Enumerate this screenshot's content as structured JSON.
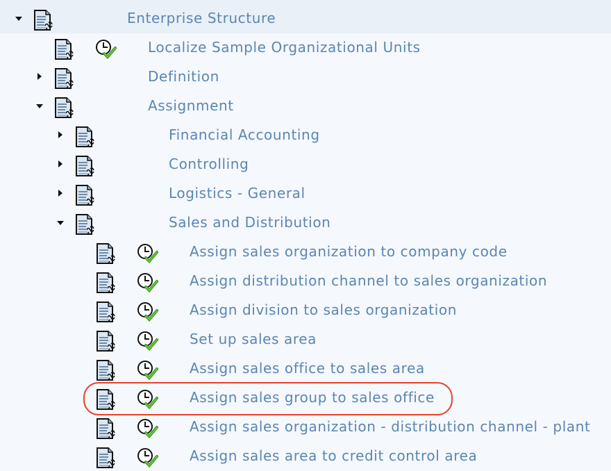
{
  "tree": {
    "items": [
      {
        "label": "Enterprise Structure",
        "level": 0,
        "expander": "expanded",
        "has_clock": false
      },
      {
        "label": "Localize Sample Organizational Units",
        "level": 1,
        "expander": "none",
        "has_clock": true
      },
      {
        "label": "Definition",
        "level": 1,
        "expander": "collapsed",
        "has_clock": false
      },
      {
        "label": "Assignment",
        "level": 1,
        "expander": "expanded",
        "has_clock": false
      },
      {
        "label": "Financial Accounting",
        "level": 2,
        "expander": "collapsed",
        "has_clock": false
      },
      {
        "label": "Controlling",
        "level": 2,
        "expander": "collapsed",
        "has_clock": false
      },
      {
        "label": "Logistics - General",
        "level": 2,
        "expander": "collapsed",
        "has_clock": false
      },
      {
        "label": "Sales and Distribution",
        "level": 2,
        "expander": "expanded",
        "has_clock": false
      },
      {
        "label": "Assign sales organization to company code",
        "level": 3,
        "expander": "none",
        "has_clock": true
      },
      {
        "label": "Assign distribution channel to sales organization",
        "level": 3,
        "expander": "none",
        "has_clock": true
      },
      {
        "label": "Assign division to sales organization",
        "level": 3,
        "expander": "none",
        "has_clock": true
      },
      {
        "label": "Set up sales area",
        "level": 3,
        "expander": "none",
        "has_clock": true
      },
      {
        "label": "Assign sales office to sales area",
        "level": 3,
        "expander": "none",
        "has_clock": true
      },
      {
        "label": "Assign sales group to sales office",
        "level": 3,
        "expander": "none",
        "has_clock": true,
        "highlighted": true
      },
      {
        "label": "Assign sales organization - distribution channel - plant",
        "level": 3,
        "expander": "none",
        "has_clock": true
      },
      {
        "label": "Assign sales area to credit control area",
        "level": 3,
        "expander": "none",
        "has_clock": true
      }
    ]
  },
  "icons": {
    "document": "img-documentation-icon",
    "clock": "execute-activity-clock-check-icon"
  },
  "colors": {
    "text": "#5b86b1",
    "highlight": "#e8412a",
    "background": "#f5f8fd",
    "header_background": "#e9f0f8"
  }
}
